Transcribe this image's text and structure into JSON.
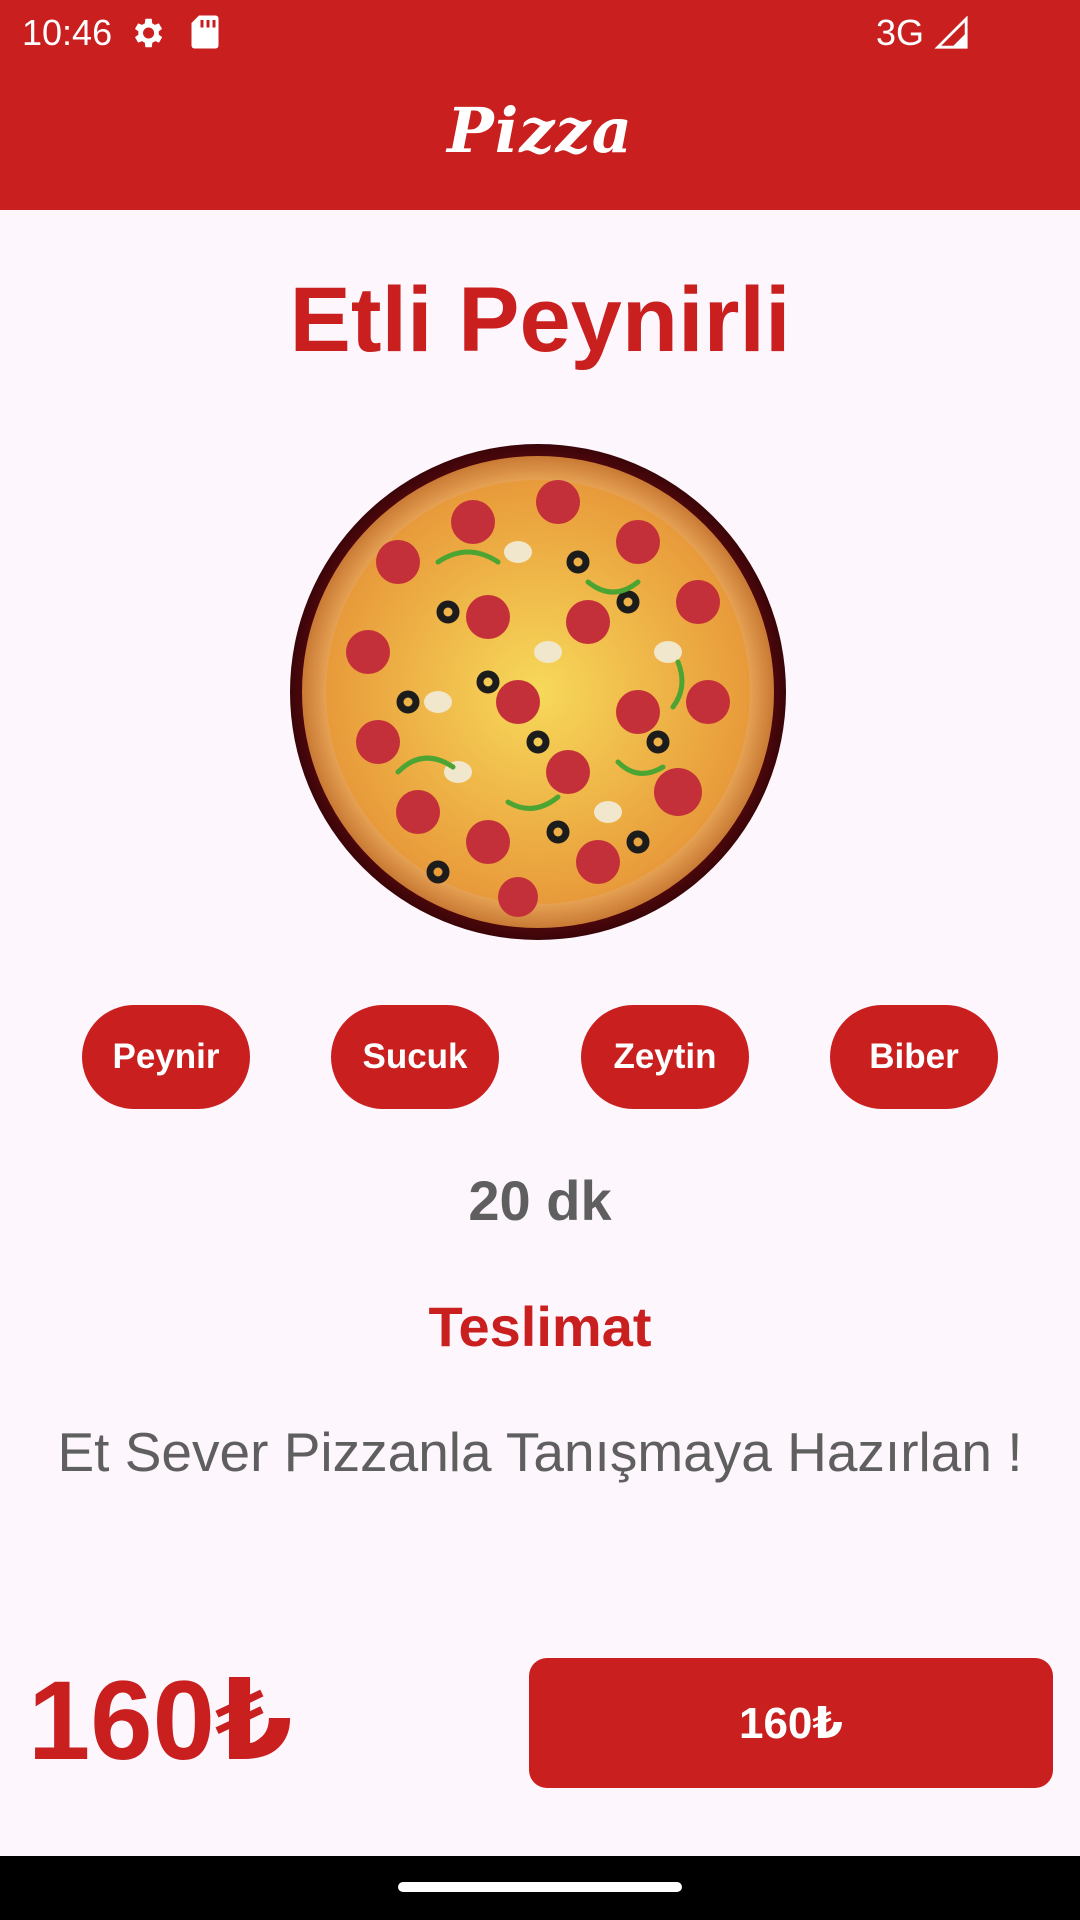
{
  "status_bar": {
    "time": "10:46",
    "network": "3G"
  },
  "app_bar": {
    "title": "Pizza"
  },
  "pizza": {
    "name": "Etli Peynirli",
    "image_icon": "pizza-image",
    "toppings": [
      "Peynir",
      "Sucuk",
      "Zeytin",
      "Biber"
    ],
    "delivery_time": "20 dk",
    "delivery_label": "Teslimat",
    "description": "Et Sever Pizzanla Tanışmaya Hazırlan !",
    "price": "160₺"
  },
  "order_button": {
    "label": "160₺"
  },
  "colors": {
    "primary": "#C91F1F",
    "background": "#FDF6FC",
    "text_gray": "#5F5F5F"
  }
}
